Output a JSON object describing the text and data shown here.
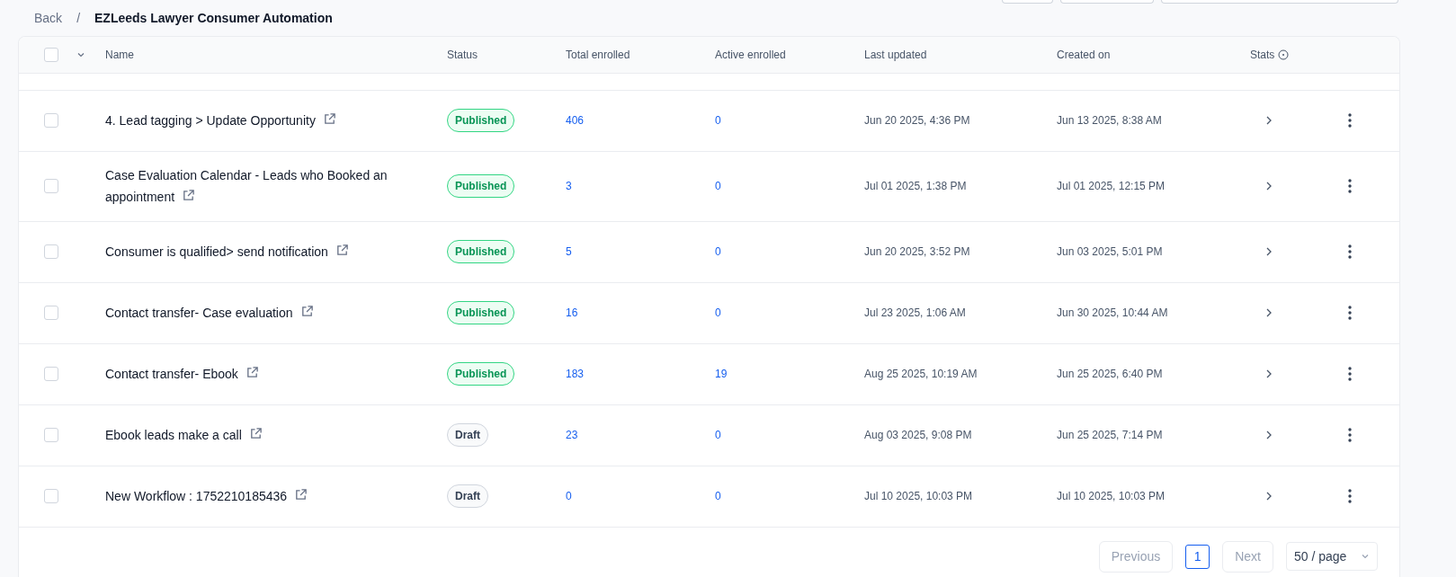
{
  "breadcrumb": {
    "back": "Back",
    "separator": "/",
    "title": "EZLeeds Lawyer Consumer Automation"
  },
  "table": {
    "select_all": {
      "checked": false
    },
    "columns": [
      {
        "label": "Name"
      },
      {
        "label": "Status"
      },
      {
        "label": "Total enrolled"
      },
      {
        "label": "Active enrolled"
      },
      {
        "label": "Last updated"
      },
      {
        "label": "Created on"
      },
      {
        "label": "Stats",
        "info": true
      }
    ],
    "rows": [
      {
        "checked": false,
        "name": "4. Lead tagging > Update Opportunity",
        "status": {
          "label": "Published",
          "kind": "published"
        },
        "total_enrolled": "406",
        "active_enrolled": "0",
        "last_updated": "Jun 20 2025, 4:36 PM",
        "created_on": "Jun 13 2025, 8:38 AM"
      },
      {
        "checked": false,
        "name": "Case Evaluation Calendar  - Leads who Booked an appointment",
        "status": {
          "label": "Published",
          "kind": "published"
        },
        "total_enrolled": "3",
        "active_enrolled": "0",
        "last_updated": "Jul 01 2025, 1:38 PM",
        "created_on": "Jul 01 2025, 12:15 PM"
      },
      {
        "checked": false,
        "name": "Consumer is qualified> send notification",
        "status": {
          "label": "Published",
          "kind": "published"
        },
        "total_enrolled": "5",
        "active_enrolled": "0",
        "last_updated": "Jun 20 2025, 3:52 PM",
        "created_on": "Jun 03 2025, 5:01 PM"
      },
      {
        "checked": false,
        "name": "Contact transfer- Case evaluation",
        "status": {
          "label": "Published",
          "kind": "published"
        },
        "total_enrolled": "16",
        "active_enrolled": "0",
        "last_updated": "Jul 23 2025, 1:06 AM",
        "created_on": "Jun 30 2025, 10:44 AM"
      },
      {
        "checked": false,
        "name": "Contact transfer- Ebook",
        "status": {
          "label": "Published",
          "kind": "published"
        },
        "total_enrolled": "183",
        "active_enrolled": "19",
        "last_updated": "Aug 25 2025, 10:19 AM",
        "created_on": "Jun 25 2025, 6:40 PM"
      },
      {
        "checked": false,
        "name": "Ebook leads make a call",
        "status": {
          "label": "Draft",
          "kind": "draft"
        },
        "total_enrolled": "23",
        "active_enrolled": "0",
        "last_updated": "Aug 03 2025, 9:08 PM",
        "created_on": "Jun 25 2025, 7:14 PM"
      },
      {
        "checked": false,
        "name": "New Workflow : 1752210185436",
        "status": {
          "label": "Draft",
          "kind": "draft"
        },
        "total_enrolled": "0",
        "active_enrolled": "0",
        "last_updated": "Jul 10 2025, 10:03 PM",
        "created_on": "Jul 10 2025, 10:03 PM"
      }
    ]
  },
  "pagination": {
    "previous": "Previous",
    "pages": [
      {
        "label": "1",
        "selected": true
      }
    ],
    "next": "Next",
    "page_size": "50 / page"
  }
}
